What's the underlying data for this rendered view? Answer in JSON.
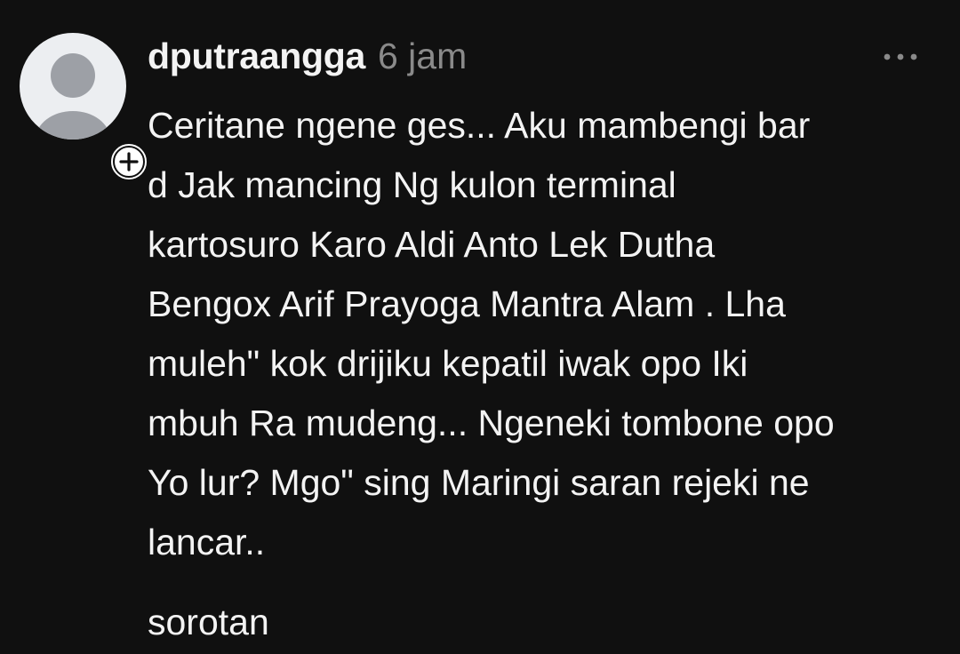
{
  "post": {
    "author": "dputraangga",
    "time": "6 jam",
    "body_lines": [
      "Ceritane ngene ges... Aku mambengi bar",
      "d Jak mancing Ng kulon terminal",
      "kartosuro Karo Aldi Anto Lek Dutha",
      "Bengox Arif Prayoga Mantra Alam . Lha",
      "muleh\" kok drijiku kepatil iwak opo Iki",
      "mbuh Ra mudeng... Ngeneki tombone opo",
      "Yo lur? Mgo\" sing Maringi saran rejeki ne",
      "lancar.."
    ],
    "translate_label": "sorotan"
  },
  "icons": {
    "avatar": "default-avatar-icon",
    "follow": "plus-icon",
    "more": "more-horizontal-icon"
  },
  "colors": {
    "background": "#101010",
    "text_primary": "#f3f3f3",
    "text_secondary": "#8a8a8a",
    "avatar_bg": "#eceef1",
    "avatar_silhouette": "#9da0a6"
  }
}
